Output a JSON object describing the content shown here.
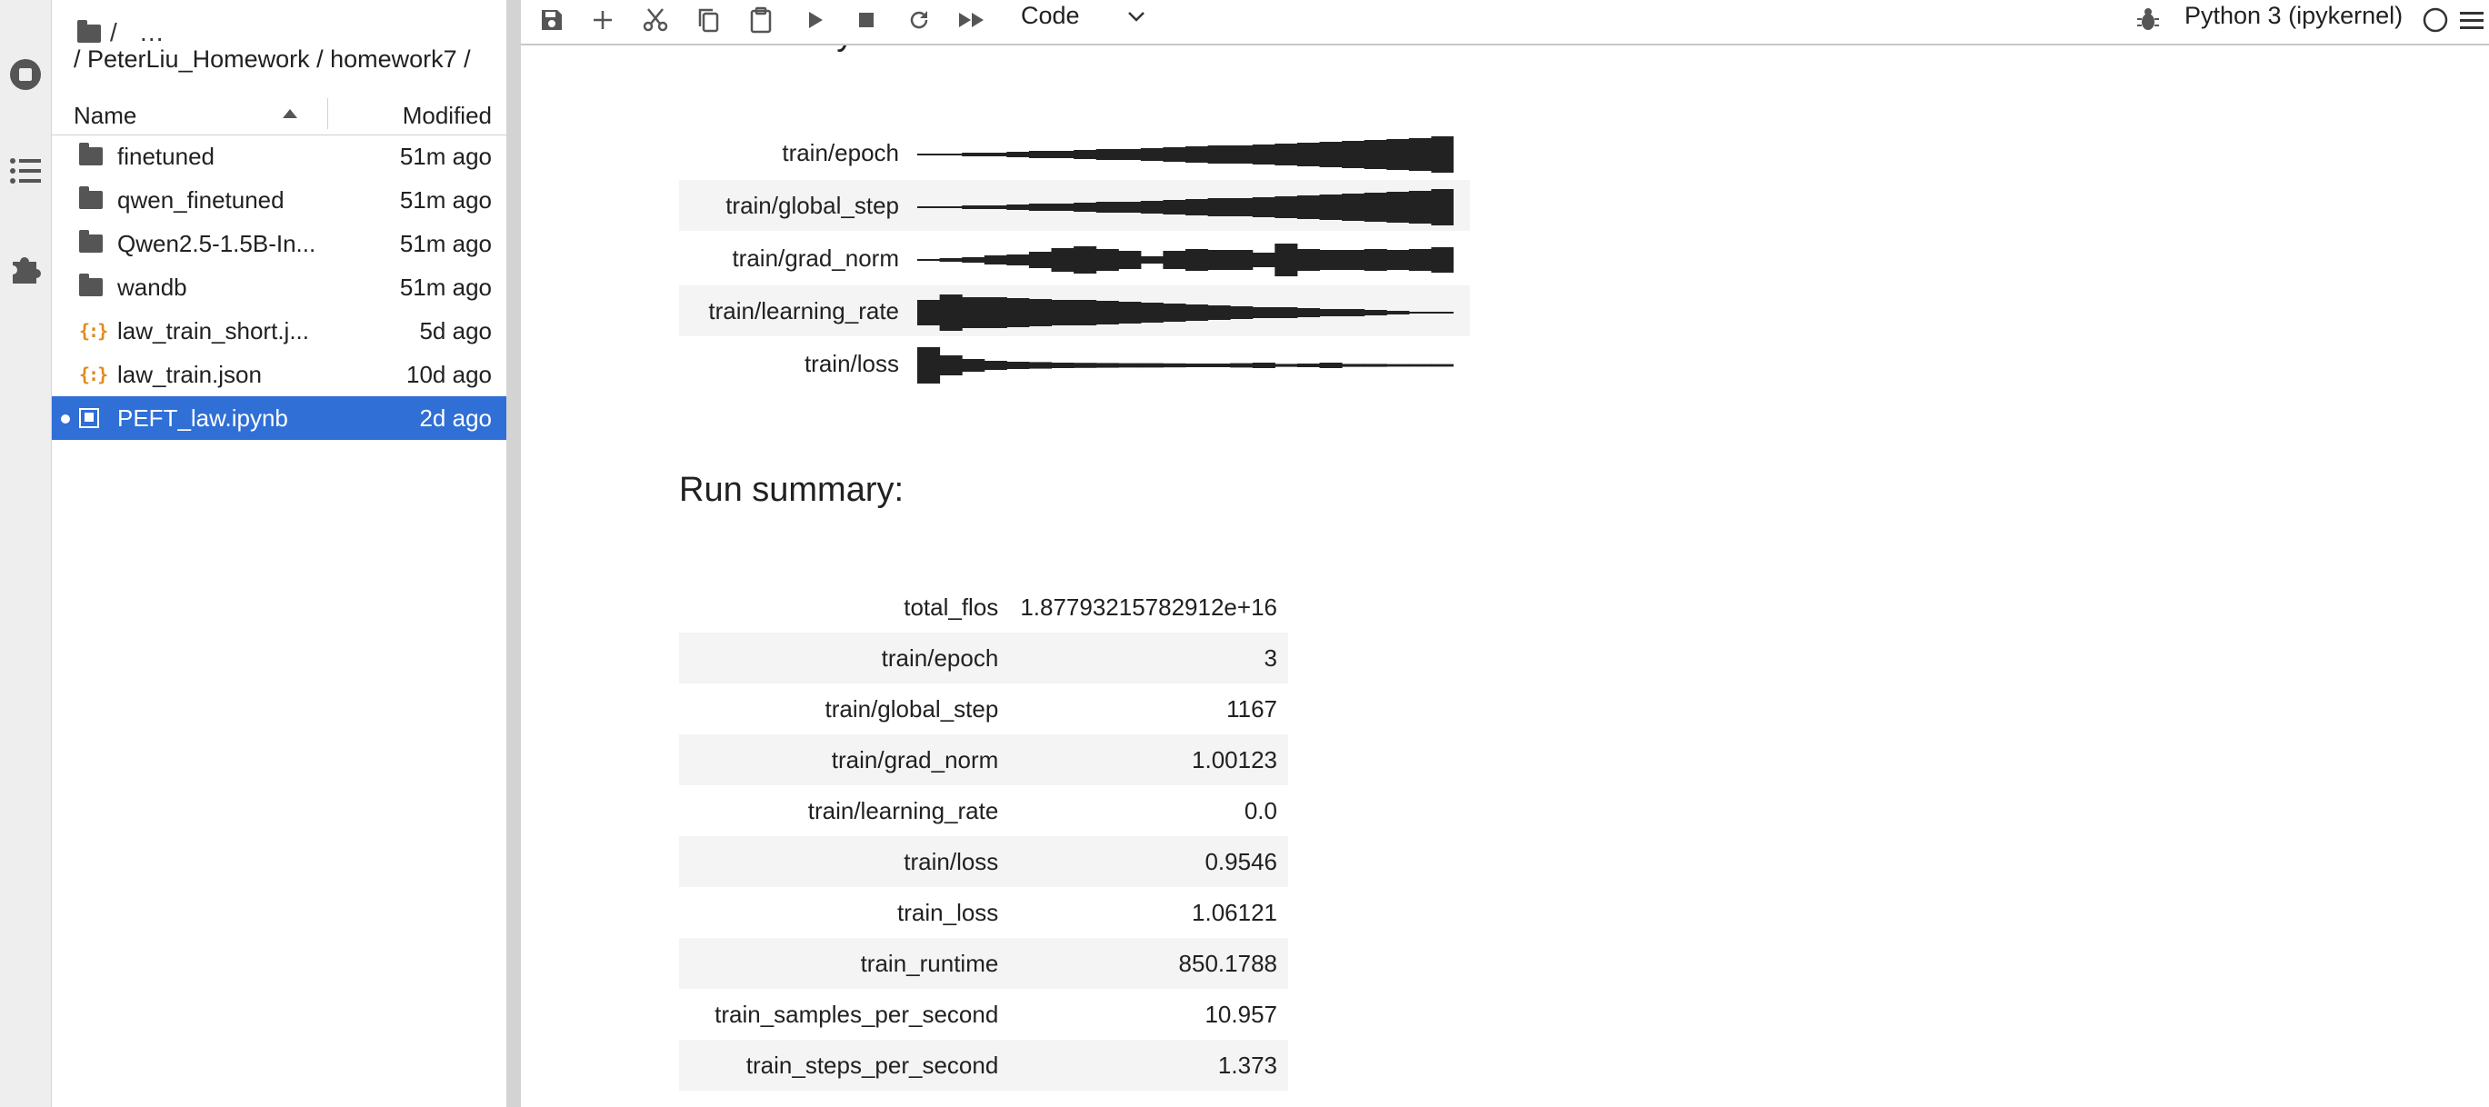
{
  "file_browser": {
    "breadcrumb_root": "/",
    "breadcrumb_more": "…",
    "breadcrumb": "/ PeterLiu_Homework / homework7 /",
    "columns": {
      "name": "Name",
      "modified": "Modified"
    },
    "files": [
      {
        "name": "finetuned",
        "modified": "51m ago",
        "kind": "folder"
      },
      {
        "name": "qwen_finetuned",
        "modified": "51m ago",
        "kind": "folder"
      },
      {
        "name": "Qwen2.5-1.5B-In...",
        "modified": "51m ago",
        "kind": "folder"
      },
      {
        "name": "wandb",
        "modified": "51m ago",
        "kind": "folder"
      },
      {
        "name": "law_train_short.j...",
        "modified": "5d ago",
        "kind": "json"
      },
      {
        "name": "law_train.json",
        "modified": "10d ago",
        "kind": "json"
      },
      {
        "name": "PEFT_law.ipynb",
        "modified": "2d ago",
        "kind": "notebook",
        "selected": true
      }
    ]
  },
  "toolbar": {
    "cell_type": "Code",
    "kernel": "Python 3 (ipykernel)",
    "icons": [
      "save-icon",
      "add-cell-icon",
      "cut-icon",
      "copy-icon",
      "paste-icon",
      "run-icon",
      "stop-icon",
      "restart-icon",
      "run-all-icon"
    ]
  },
  "output": {
    "run_history_title": "Run history:",
    "history": [
      {
        "label": "train/epoch",
        "spark": [
          0.05,
          0.05,
          0.1,
          0.1,
          0.15,
          0.2,
          0.2,
          0.25,
          0.3,
          0.3,
          0.35,
          0.4,
          0.45,
          0.5,
          0.5,
          0.55,
          0.6,
          0.65,
          0.7,
          0.75,
          0.8,
          0.85,
          0.9,
          1.0
        ]
      },
      {
        "label": "train/global_step",
        "spark": [
          0.05,
          0.05,
          0.1,
          0.1,
          0.15,
          0.2,
          0.2,
          0.25,
          0.3,
          0.3,
          0.35,
          0.4,
          0.45,
          0.5,
          0.5,
          0.55,
          0.6,
          0.65,
          0.7,
          0.75,
          0.8,
          0.85,
          0.9,
          1.0
        ]
      },
      {
        "label": "train/grad_norm",
        "spark": [
          0.05,
          0.1,
          0.15,
          0.25,
          0.3,
          0.45,
          0.65,
          0.75,
          0.6,
          0.5,
          0.2,
          0.5,
          0.6,
          0.55,
          0.55,
          0.4,
          0.9,
          0.6,
          0.55,
          0.55,
          0.6,
          0.55,
          0.6,
          0.7
        ]
      },
      {
        "label": "train/learning_rate",
        "spark": [
          0.7,
          1.0,
          0.85,
          0.85,
          0.8,
          0.75,
          0.7,
          0.7,
          0.65,
          0.6,
          0.55,
          0.5,
          0.45,
          0.4,
          0.35,
          0.3,
          0.3,
          0.25,
          0.2,
          0.2,
          0.15,
          0.1,
          0.05,
          0.02
        ]
      },
      {
        "label": "train/loss",
        "spark": [
          1.0,
          0.55,
          0.35,
          0.25,
          0.2,
          0.18,
          0.15,
          0.14,
          0.13,
          0.12,
          0.12,
          0.11,
          0.1,
          0.1,
          0.12,
          0.15,
          0.08,
          0.1,
          0.15,
          0.08,
          0.08,
          0.07,
          0.07,
          0.07
        ]
      }
    ],
    "run_summary_title": "Run summary:",
    "summary": [
      {
        "key": "total_flos",
        "value": "1.87793215782912e+16"
      },
      {
        "key": "train/epoch",
        "value": "3"
      },
      {
        "key": "train/global_step",
        "value": "1167"
      },
      {
        "key": "train/grad_norm",
        "value": "1.00123"
      },
      {
        "key": "train/learning_rate",
        "value": "0.0"
      },
      {
        "key": "train/loss",
        "value": "0.9546"
      },
      {
        "key": "train_loss",
        "value": "1.06121"
      },
      {
        "key": "train_runtime",
        "value": "850.1788"
      },
      {
        "key": "train_samples_per_second",
        "value": "10.957"
      },
      {
        "key": "train_steps_per_second",
        "value": "1.373"
      }
    ]
  },
  "colors": {
    "selection": "#2f6fd6",
    "json_icon": "#e08a1e",
    "row_shade": "#f4f4f4"
  }
}
